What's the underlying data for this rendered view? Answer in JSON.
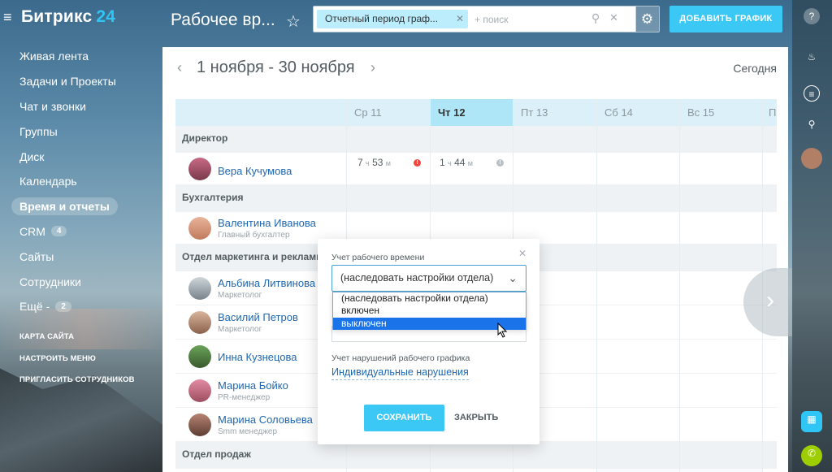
{
  "app": {
    "name": "Битрикс",
    "number": "24"
  },
  "menu": {
    "items": [
      {
        "label": "Живая лента"
      },
      {
        "label": "Задачи и Проекты"
      },
      {
        "label": "Чат и звонки"
      },
      {
        "label": "Группы"
      },
      {
        "label": "Диск"
      },
      {
        "label": "Календарь"
      },
      {
        "label": "Время и отчеты",
        "active": true
      },
      {
        "label": "CRM",
        "count": "4"
      },
      {
        "label": "Сайты"
      },
      {
        "label": "Сотрудники"
      },
      {
        "label": "Ещё",
        "count": "2"
      }
    ],
    "more_dash": "-",
    "site_map": "КАРТА САЙТА",
    "configure": "НАСТРОИТЬ МЕНЮ",
    "invite": "ПРИГЛАСИТЬ СОТРУДНИКОВ"
  },
  "header": {
    "title": "Рабочее вр...",
    "filter_chip": "Отчетный период граф...",
    "search_placeholder": "+ поиск",
    "add_button": "ДОБАВИТЬ ГРАФИК"
  },
  "calendar": {
    "period": "1 ноября - 30 ноября",
    "today_label": "Сегодня",
    "days": [
      "Ср 11",
      "Чт 12",
      "Пт 13",
      "Сб 14",
      "Вс 15",
      "Пн"
    ],
    "today_index": 1
  },
  "rows": {
    "dept1": "Директор",
    "emp1": {
      "name": "Вера Кучумова",
      "day1_h": "7",
      "day1_m": "53",
      "day2_h": "1",
      "day2_m": "44"
    },
    "dept2": "Бухгалтерия",
    "emp2": {
      "name": "Валентина Иванова",
      "position": "Главный бухгалтер"
    },
    "dept3": "Отдел маркетинга и рекламы",
    "emp3": {
      "name": "Альбина Литвинова",
      "position": "Маркетолог"
    },
    "emp4": {
      "name": "Василий Петров",
      "position": "Маркетолог"
    },
    "emp5": {
      "name": "Инна Кузнецова"
    },
    "emp6": {
      "name": "Марина Бойко",
      "position": "PR-менеджер"
    },
    "emp7": {
      "name": "Марина Соловьева",
      "position": "Smm менеджер"
    },
    "dept4": "Отдел продаж",
    "unit_h": "ч",
    "unit_m": "м"
  },
  "popup": {
    "label1": "Учет рабочего времени",
    "select_value": "(наследовать настройки отдела)",
    "options": [
      "(наследовать настройки отдела)",
      "включен",
      "выключен"
    ],
    "selected_index": 2,
    "label2": "Учет нарушений рабочего графика",
    "violations_link": "Индивидуальные нарушения",
    "save": "СОХРАНИТЬ",
    "close": "ЗАКРЫТЬ"
  },
  "colors": {
    "accent": "#3bc8f5",
    "link": "#2067b0",
    "today_col": "#aee5f7"
  }
}
